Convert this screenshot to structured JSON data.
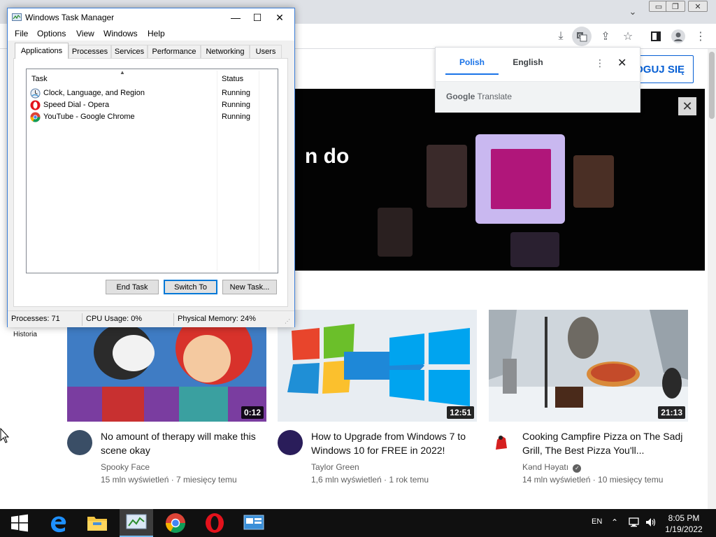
{
  "browser": {
    "signin_label": "OGUJ SIĘ",
    "sidebar_history": "Historia",
    "banner_text": "n do",
    "banner_close": "✕"
  },
  "translate": {
    "lang_from": "Polish",
    "lang_to": "English",
    "brand_google": "Google",
    "brand_product": "Translate",
    "more_icon": "⋮",
    "close_icon": "✕"
  },
  "videos": [
    {
      "title": "No amount of therapy will make this scene okay",
      "channel": "Spooky Face",
      "meta": "15 mln wyświetleń · 7 miesięcy temu",
      "duration": "0:12"
    },
    {
      "title": "How to Upgrade from Windows 7 to Windows 10 for FREE in 2022!",
      "channel": "Taylor Green",
      "meta": "1,6 mln wyświetleń · 1 rok temu",
      "duration": "12:51"
    },
    {
      "title": "Cooking Campfire Pizza on The Sadj Grill, The Best Pizza You'll...",
      "channel": "Kənd Həyatı",
      "meta": "14 mln wyświetleń · 10 miesięcy temu",
      "duration": "21:13",
      "verified": true
    }
  ],
  "taskmgr": {
    "title": "Windows Task Manager",
    "menu": [
      "File",
      "Options",
      "View",
      "Windows",
      "Help"
    ],
    "tabs": [
      "Applications",
      "Processes",
      "Services",
      "Performance",
      "Networking",
      "Users"
    ],
    "columns": {
      "task": "Task",
      "status": "Status"
    },
    "rows": [
      {
        "name": "Clock, Language, and Region",
        "status": "Running",
        "icon": "clock-language-region-icon"
      },
      {
        "name": "Speed Dial - Opera",
        "status": "Running",
        "icon": "opera-icon"
      },
      {
        "name": "YouTube - Google Chrome",
        "status": "Running",
        "icon": "chrome-icon"
      }
    ],
    "buttons": {
      "end_task": "End Task",
      "switch_to": "Switch To",
      "new_task": "New Task..."
    },
    "status": {
      "processes": "Processes: 71",
      "cpu": "CPU Usage: 0%",
      "memory": "Physical Memory: 24%"
    }
  },
  "taskbar": {
    "lang": "EN",
    "time": "8:05 PM",
    "date": "1/19/2022"
  },
  "colors": {
    "accent_blue": "#065fd4",
    "translate_blue": "#1a73e8",
    "taskbar": "#101010"
  }
}
